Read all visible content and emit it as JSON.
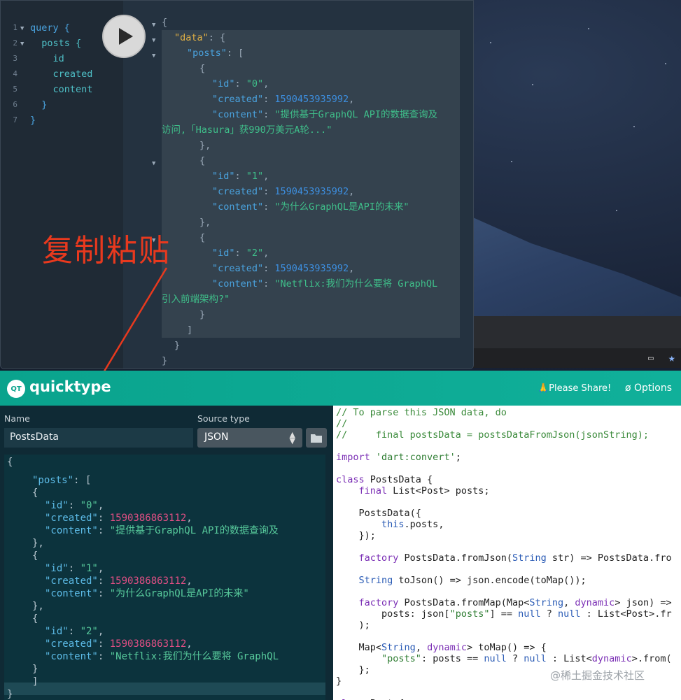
{
  "graphiql": {
    "query_lines": [
      {
        "n": "1",
        "fold": true,
        "text": "query {",
        "cls": ""
      },
      {
        "n": "2",
        "fold": true,
        "text": "  posts {",
        "cls": "field"
      },
      {
        "n": "3",
        "fold": false,
        "text": "    id",
        "cls": "field"
      },
      {
        "n": "4",
        "fold": false,
        "text": "    created",
        "cls": "field"
      },
      {
        "n": "5",
        "fold": false,
        "text": "    content",
        "cls": "field"
      },
      {
        "n": "6",
        "fold": false,
        "text": "  }",
        "cls": ""
      },
      {
        "n": "7",
        "fold": false,
        "text": "}",
        "cls": ""
      }
    ],
    "result": {
      "data_key": "\"data\"",
      "posts_key": "\"posts\"",
      "items": [
        {
          "id": "\"0\"",
          "created": "1590453935992",
          "content": "\"提供基于GraphQL API的数据查询及",
          "content2": "访问,「Hasura」获990万美元A轮...\""
        },
        {
          "id": "\"1\"",
          "created": "1590453935992",
          "content": "\"为什么GraphQL是API的未来\"",
          "content2": ""
        },
        {
          "id": "\"2\"",
          "created": "1590453935992",
          "content": "\"Netflix:我们为什么要将 GraphQL",
          "content2": "引入前端架构?\""
        }
      ]
    }
  },
  "annotation": "复制粘贴",
  "quicktype": {
    "logo_text": "QT",
    "title": "quicktype",
    "share": "🙏Please Share!",
    "options": "Options",
    "name_label": "Name",
    "name_value": "PostsData",
    "source_label": "Source type",
    "source_value": "JSON",
    "json_items": [
      {
        "id": "\"0\"",
        "created": "1590386863112",
        "content": "\"提供基于GraphQL API的数据查询及"
      },
      {
        "id": "\"1\"",
        "created": "1590386863112",
        "content": "\"为什么GraphQL是API的未来\""
      },
      {
        "id": "\"2\"",
        "created": "1590386863112",
        "content": "\"Netflix:我们为什么要将 GraphQL"
      }
    ],
    "dart_lines": [
      [
        [
          "dc",
          "// To parse this JSON data, do"
        ]
      ],
      [
        [
          "dc",
          "//"
        ]
      ],
      [
        [
          "dc",
          "//     final postsData = postsDataFromJson(jsonString);"
        ]
      ],
      [],
      [
        [
          "dkw",
          "import "
        ],
        [
          "dst",
          "'dart:convert'"
        ],
        [
          "",
          ";"
        ]
      ],
      [],
      [
        [
          "dkw",
          "class "
        ],
        [
          "",
          "PostsData {"
        ]
      ],
      [
        [
          "",
          "    "
        ],
        [
          "dkw",
          "final "
        ],
        [
          "",
          "List<Post> posts;"
        ]
      ],
      [],
      [
        [
          "",
          "    PostsData({"
        ]
      ],
      [
        [
          "",
          "        "
        ],
        [
          "dty",
          "this"
        ],
        [
          "",
          ".posts,"
        ]
      ],
      [
        [
          "",
          "    });"
        ]
      ],
      [],
      [
        [
          "",
          "    "
        ],
        [
          "dkw",
          "factory "
        ],
        [
          "",
          "PostsData.fromJson("
        ],
        [
          "dty",
          "String"
        ],
        [
          "",
          " str) => PostsData.fro"
        ]
      ],
      [],
      [
        [
          "",
          "    "
        ],
        [
          "dty",
          "String"
        ],
        [
          "",
          " toJson() => json.encode(toMap());"
        ]
      ],
      [],
      [
        [
          "",
          "    "
        ],
        [
          "dkw",
          "factory "
        ],
        [
          "",
          "PostsData.fromMap(Map<"
        ],
        [
          "dty",
          "String"
        ],
        [
          "",
          ", "
        ],
        [
          "dkw",
          "dynamic"
        ],
        [
          "",
          "> json) =>"
        ]
      ],
      [
        [
          "",
          "        posts: json["
        ],
        [
          "dst",
          "\"posts\""
        ],
        [
          "",
          "] == "
        ],
        [
          "dnl",
          "null"
        ],
        [
          "",
          " ? "
        ],
        [
          "dnl",
          "null"
        ],
        [
          "",
          " : List<Post>.fr"
        ]
      ],
      [
        [
          "",
          "    );"
        ]
      ],
      [],
      [
        [
          "",
          "    Map<"
        ],
        [
          "dty",
          "String"
        ],
        [
          "",
          ", "
        ],
        [
          "dkw",
          "dynamic"
        ],
        [
          "",
          "> toMap() => {"
        ]
      ],
      [
        [
          "",
          "        "
        ],
        [
          "dst",
          "\"posts\""
        ],
        [
          "",
          ": posts == "
        ],
        [
          "dnl",
          "null"
        ],
        [
          "",
          " ? "
        ],
        [
          "dnl",
          "null"
        ],
        [
          "",
          " : List<"
        ],
        [
          "dkw",
          "dynamic"
        ],
        [
          "",
          ">.from("
        ]
      ],
      [
        [
          "",
          "    };"
        ]
      ],
      [
        [
          "",
          "}"
        ]
      ],
      [],
      [
        [
          "dkw",
          "class "
        ],
        [
          "",
          "Post {"
        ]
      ]
    ]
  },
  "watermark": "@稀土掘金技术社区"
}
